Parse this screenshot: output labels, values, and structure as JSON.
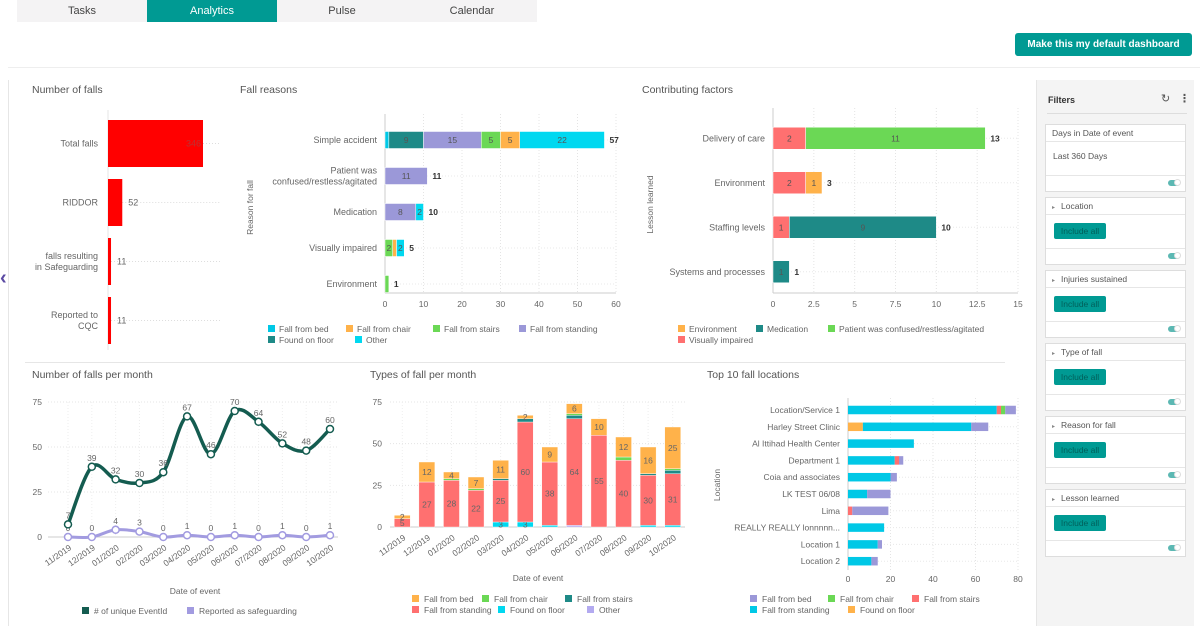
{
  "tabs": [
    {
      "label": "Tasks",
      "active": false
    },
    {
      "label": "Analytics",
      "active": true
    },
    {
      "label": "Pulse",
      "active": false
    },
    {
      "label": "Calendar",
      "active": false
    }
  ],
  "default_button": "Make this my default dashboard",
  "back_icon": "‹",
  "colors": {
    "accent": "#009a93",
    "red": "#ff0000",
    "cyan": "#00c8e6",
    "teal_dark": "#1e8a87",
    "purple": "#9b98d8",
    "green": "#6bd855",
    "orange": "#ffb24a",
    "salmon": "#ff7070",
    "dark_green_line": "#145c50"
  },
  "filters": {
    "title": "Filters",
    "refresh_icon": "↻",
    "menu_icon": "⋮",
    "cards": [
      {
        "label": "Days in Date of event",
        "value": "Last 360 Days",
        "button": null,
        "has_caret": false
      },
      {
        "label": "Location",
        "value": null,
        "button": "Include all",
        "has_caret": true
      },
      {
        "label": "Injuries sustained",
        "value": null,
        "button": "Include all",
        "has_caret": true
      },
      {
        "label": "Type of fall",
        "value": null,
        "button": "Include all",
        "has_caret": true
      },
      {
        "label": "Reason for fall",
        "value": null,
        "button": "Include all",
        "has_caret": true
      },
      {
        "label": "Lesson learned",
        "value": null,
        "button": "Include all",
        "has_caret": true
      }
    ]
  },
  "chart_data": [
    {
      "id": "falls",
      "type": "bar",
      "orientation": "horizontal",
      "title": "Number of falls",
      "categories": [
        "Total falls",
        "RIDDOR",
        "falls resulting in Safeguarding",
        "Reported to CQC"
      ],
      "values": [
        346,
        52,
        11,
        11
      ],
      "xlim": [
        0,
        346
      ],
      "grid": true
    },
    {
      "id": "reasons",
      "type": "bar",
      "stacked": true,
      "orientation": "horizontal",
      "title": "Fall reasons",
      "ylabel": "Reason for fall",
      "categories": [
        "Simple accident",
        "Patient was confused/restless/agitated",
        "Medication",
        "Visually impaired",
        "Environment"
      ],
      "series": [
        {
          "name": "Fall from bed",
          "color": "#00c8e6",
          "values": [
            1,
            0,
            0,
            0,
            0
          ]
        },
        {
          "name": "Found on floor",
          "color": "#1e8a87",
          "values": [
            9,
            0,
            0,
            0,
            0
          ]
        },
        {
          "name": "Fall from standing",
          "color": "#9b98d8",
          "values": [
            15,
            11,
            8,
            0,
            0
          ]
        },
        {
          "name": "Fall from stairs",
          "color": "#6bd855",
          "values": [
            5,
            0,
            0,
            2,
            1
          ]
        },
        {
          "name": "Fall from chair",
          "color": "#ffb24a",
          "values": [
            5,
            0,
            0,
            1,
            0
          ]
        },
        {
          "name": "Other",
          "color": "#00d8f0",
          "values": [
            22,
            0,
            2,
            2,
            0
          ]
        }
      ],
      "totals": [
        57,
        11,
        10,
        5,
        1
      ],
      "xticks": [
        "0",
        "10",
        "20",
        "30",
        "40",
        "50",
        "60"
      ],
      "xlim": [
        0,
        60
      ],
      "legend": [
        {
          "name": "Fall from bed",
          "color": "#00c8e6"
        },
        {
          "name": "Fall from chair",
          "color": "#ffb24a"
        },
        {
          "name": "Fall from stairs",
          "color": "#6bd855"
        },
        {
          "name": "Fall from standing",
          "color": "#9b98d8"
        },
        {
          "name": "Found on floor",
          "color": "#1e8a87"
        },
        {
          "name": "Other",
          "color": "#00d8f0"
        }
      ],
      "legend_position": "bottom",
      "grid": true
    },
    {
      "id": "factors",
      "type": "bar",
      "stacked": true,
      "orientation": "horizontal",
      "title": "Contributing factors",
      "ylabel": "Lesson learned",
      "categories": [
        "Delivery of care",
        "Environment",
        "Staffing levels",
        "Systems and processes"
      ],
      "series": [
        {
          "name": "Visually impaired",
          "color": "#ff7070",
          "values": [
            2,
            2,
            1,
            0
          ]
        },
        {
          "name": "Environment",
          "color": "#ffb24a",
          "values": [
            0,
            1,
            0,
            0
          ]
        },
        {
          "name": "Medication",
          "color": "#1e8a87",
          "values": [
            0,
            0,
            9,
            1
          ]
        },
        {
          "name": "Patient was confused/restless/agitated",
          "color": "#6bd855",
          "values": [
            11,
            0,
            0,
            0
          ]
        }
      ],
      "totals": [
        13,
        3,
        10,
        1
      ],
      "xticks": [
        "0",
        "2.5",
        "5",
        "7.5",
        "10",
        "12.5",
        "15"
      ],
      "xlim": [
        0,
        15
      ],
      "legend": [
        {
          "name": "Environment",
          "color": "#ffb24a"
        },
        {
          "name": "Medication",
          "color": "#1e8a87"
        },
        {
          "name": "Patient was confused/restless/agitated",
          "color": "#6bd855"
        },
        {
          "name": "Visually impaired",
          "color": "#ff7070"
        }
      ],
      "legend_position": "bottom",
      "grid": true
    },
    {
      "id": "monthly",
      "type": "line",
      "title": "Number of falls per month",
      "xlabel": "Date of event",
      "categories": [
        "11/2019",
        "12/2019",
        "01/2020",
        "02/2020",
        "03/2020",
        "04/2020",
        "05/2020",
        "06/2020",
        "07/2020",
        "08/2020",
        "09/2020",
        "10/2020"
      ],
      "series": [
        {
          "name": "# of unique EventId",
          "color": "#145c50",
          "values": [
            7,
            39,
            32,
            30,
            36,
            67,
            46,
            70,
            64,
            52,
            48,
            60
          ]
        },
        {
          "name": "Reported as safeguarding",
          "color": "#a29be0",
          "values": [
            0,
            0,
            4,
            3,
            0,
            1,
            0,
            1,
            0,
            1,
            0,
            1
          ]
        }
      ],
      "yticks": [
        "0",
        "25",
        "50",
        "75"
      ],
      "ylim": [
        0,
        75
      ],
      "legend_position": "bottom",
      "grid": true
    },
    {
      "id": "types",
      "type": "bar",
      "stacked": true,
      "title": "Types of fall per month",
      "xlabel": "Date of event",
      "categories": [
        "11/2019",
        "12/2019",
        "01/2020",
        "02/2020",
        "03/2020",
        "04/2020",
        "05/2020",
        "06/2020",
        "07/2020",
        "08/2020",
        "09/2020",
        "10/2020"
      ],
      "series": [
        {
          "name": "Other",
          "color": "#b3aaf0",
          "values": [
            0,
            0,
            0,
            0,
            0,
            0,
            0,
            1,
            0,
            0,
            0,
            0
          ]
        },
        {
          "name": "Found on floor",
          "color": "#00d8f0",
          "values": [
            0,
            0,
            0,
            0,
            3,
            3,
            1,
            0,
            0,
            0,
            1,
            1
          ]
        },
        {
          "name": "Fall from standing",
          "color": "#ff7070",
          "values": [
            5,
            27,
            28,
            22,
            25,
            60,
            38,
            64,
            55,
            40,
            30,
            31
          ]
        },
        {
          "name": "Fall from stairs",
          "color": "#1e8a87",
          "values": [
            0,
            0,
            0,
            0,
            1,
            2,
            0,
            2,
            0,
            0,
            1,
            2
          ]
        },
        {
          "name": "Fall from chair",
          "color": "#6bd855",
          "values": [
            0,
            0,
            1,
            1,
            0,
            0,
            0,
            1,
            0,
            2,
            0,
            1
          ]
        },
        {
          "name": "Fall from bed",
          "color": "#ffb24a",
          "values": [
            2,
            12,
            4,
            7,
            11,
            2,
            9,
            6,
            10,
            12,
            16,
            25
          ]
        }
      ],
      "yticks": [
        "0",
        "25",
        "50",
        "75"
      ],
      "ylim": [
        0,
        75
      ],
      "legend": [
        {
          "name": "Fall from bed",
          "color": "#ffb24a"
        },
        {
          "name": "Fall from chair",
          "color": "#6bd855"
        },
        {
          "name": "Fall from stairs",
          "color": "#1e8a87"
        },
        {
          "name": "Fall from standing",
          "color": "#ff7070"
        },
        {
          "name": "Found on floor",
          "color": "#00d8f0"
        },
        {
          "name": "Other",
          "color": "#b3aaf0"
        }
      ],
      "legend_position": "bottom",
      "grid": true
    },
    {
      "id": "locations",
      "type": "bar",
      "stacked": true,
      "orientation": "horizontal",
      "title": "Top 10 fall locations",
      "ylabel": "Location",
      "categories": [
        "Location/Service 1",
        "Harley Street Clinic",
        "Al Ittihad Health Center",
        "Department 1",
        "Coia and associates",
        "LK TEST 06/08",
        "Lima",
        "REALLY REALLY lonnnnn...",
        "Location 1",
        "Location 2"
      ],
      "series": [
        {
          "name": "Found on floor",
          "color": "#ffb24a",
          "values": [
            0,
            7,
            0,
            0,
            0,
            0,
            0,
            0,
            0,
            0
          ]
        },
        {
          "name": "Fall from stairs",
          "color": "#ff7070",
          "values": [
            0,
            0,
            0,
            0,
            0,
            0,
            2,
            0,
            0,
            0
          ]
        },
        {
          "name": "Fall from standing",
          "color": "#00c8e6",
          "values": [
            70,
            51,
            31,
            22,
            20,
            9,
            0,
            17,
            14,
            11
          ]
        },
        {
          "name": "Fall from stairs 2",
          "color": "#ff7070",
          "values": [
            2,
            0,
            0,
            2,
            0,
            0,
            0,
            0,
            0,
            0
          ]
        },
        {
          "name": "Fall from chair",
          "color": "#6bd855",
          "values": [
            2,
            0,
            0,
            0,
            0,
            0,
            0,
            0,
            0,
            0
          ]
        },
        {
          "name": "Fall from bed",
          "color": "#9b98d8",
          "values": [
            5,
            8,
            0,
            2,
            3,
            11,
            17,
            0,
            2,
            3
          ]
        }
      ],
      "xticks": [
        "0",
        "20",
        "40",
        "60",
        "80"
      ],
      "xlim": [
        0,
        80
      ],
      "legend": [
        {
          "name": "Fall from bed",
          "color": "#9b98d8"
        },
        {
          "name": "Fall from chair",
          "color": "#6bd855"
        },
        {
          "name": "Fall from stairs",
          "color": "#ff7070"
        },
        {
          "name": "Fall from standing",
          "color": "#00c8e6"
        },
        {
          "name": "Found on floor",
          "color": "#ffb24a"
        }
      ],
      "legend_position": "bottom",
      "grid": true
    }
  ]
}
